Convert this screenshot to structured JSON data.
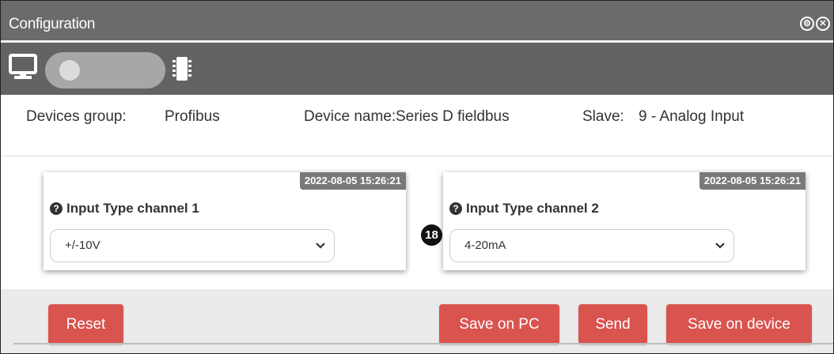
{
  "window": {
    "title": "Configuration",
    "icons": [
      "settings-circle-icon",
      "close-circle-icon"
    ],
    "icon_glyphs": [
      "⚙",
      "✕"
    ]
  },
  "toolbar": {
    "left_icon": "monitor-icon",
    "right_icon": "chip-icon",
    "toggle_state": "off"
  },
  "info": {
    "group_label": "Devices group:",
    "group_value": "Profibus",
    "device_label": "Device name:",
    "device_value": "Series D fieldbus",
    "slave_label": "Slave:",
    "slave_value": "9 - Analog Input"
  },
  "channels": [
    {
      "timestamp": "2022-08-05 15:26:21",
      "title": "Input Type channel 1",
      "value": "+/-10V"
    },
    {
      "timestamp": "2022-08-05 15:26:21",
      "title": "Input Type channel 2",
      "value": "4-20mA"
    }
  ],
  "step_marker": "18",
  "buttons": {
    "reset": "Reset",
    "save_pc": "Save on PC",
    "send": "Send",
    "save_device": "Save on device"
  },
  "colors": {
    "titlebar": "#6b6b6b",
    "toolbar": "#636363",
    "danger_button": "#d9534f",
    "badge": "#797979"
  }
}
